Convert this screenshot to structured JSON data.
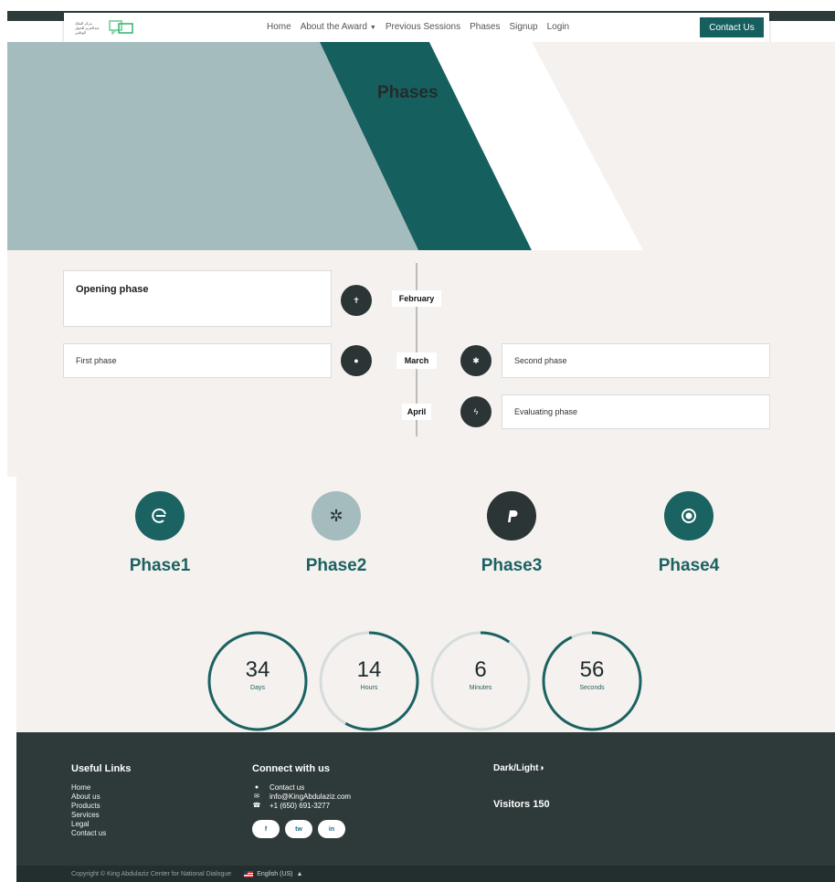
{
  "colors": {
    "accent": "#165f5f",
    "dark": "#2e3a3a",
    "hero_gray": "#a5bcbe",
    "background": "#f5f1ee"
  },
  "nav": {
    "logo_text": "مركز الملك عبدالعزيز للحوار الوطني",
    "logo_icon": "chat-bubbles-icon",
    "links": [
      "Home",
      "About the Award",
      "Previous Sessions",
      "Phases",
      "Signup",
      "Login"
    ],
    "contact_label": "Contact Us"
  },
  "hero": {
    "title": "Phases"
  },
  "timeline": {
    "months": [
      "February",
      "March",
      "April"
    ],
    "cards": [
      "Opening phase",
      "First phase",
      "Second phase",
      "Evaluating phase"
    ],
    "dot_icons": [
      "pin-icon",
      "circle-icon",
      "asterisk-icon",
      "bolt-icon"
    ]
  },
  "phases": [
    {
      "label": "Phase1",
      "icon": "edge-icon",
      "color": "#1b6262"
    },
    {
      "label": "Phase2",
      "icon": "yelp-icon",
      "color": "#a5bcbe"
    },
    {
      "label": "Phase3",
      "icon": "paypal-icon",
      "color": "#2b3535"
    },
    {
      "label": "Phase4",
      "icon": "target-icon",
      "color": "#1b6262"
    }
  ],
  "countdown": [
    {
      "value": "34",
      "unit": "Days",
      "progress": 1.0
    },
    {
      "value": "14",
      "unit": "Hours",
      "progress": 0.58
    },
    {
      "value": "6",
      "unit": "Minutes",
      "progress": 0.1
    },
    {
      "value": "56",
      "unit": "Seconds",
      "progress": 0.93
    }
  ],
  "footer": {
    "useful_links_title": "Useful Links",
    "useful_links": [
      "Home",
      "About us",
      "Products",
      "Services",
      "Legal",
      "Contact us"
    ],
    "connect_title": "Connect with us",
    "contacts": [
      {
        "icon": "chat-icon",
        "text": "Contact us"
      },
      {
        "icon": "mail-icon",
        "text": "info@KingAbdulaziz.com"
      },
      {
        "icon": "phone-icon",
        "text": "+1 (650) 691-3277"
      }
    ],
    "socials": [
      "f",
      "tw",
      "in"
    ],
    "theme_toggle": "Dark/Light",
    "visitors": "Visitors 150"
  },
  "bottom": {
    "copyright": "Copyright © King Abdulaziz Center for National Dialogue",
    "language": "English (US)"
  }
}
